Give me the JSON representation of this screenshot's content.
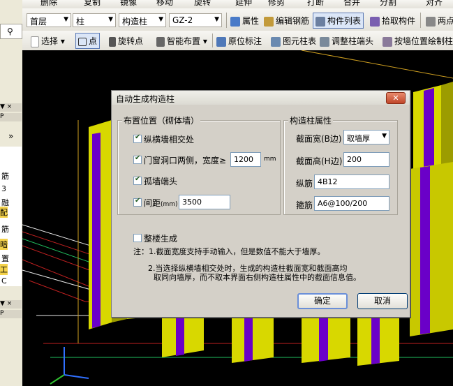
{
  "toolbar_top": {
    "items": [
      "删除",
      "复制",
      "镜像",
      "移动",
      "旋转",
      "延伸",
      "修剪",
      "打断",
      "合并",
      "分割",
      "对齐"
    ]
  },
  "toolbar1": {
    "floor": "首层",
    "category": "柱",
    "type": "构造柱",
    "element": "GZ-2",
    "properties": "属性",
    "edit_rebar": "编辑钢筋",
    "component_list": "构件列表",
    "pick_component": "拾取构件",
    "two_point": "两点"
  },
  "toolbar2": {
    "select": "选择",
    "point": "点",
    "rotate_point": "旋转点",
    "smart_layout": "智能布置",
    "origin_mark": "原位标注",
    "schedule": "图元柱表",
    "adjust_end": "调整柱端头",
    "draw_by_wall": "按墙位置绘制柱"
  },
  "left_panel": {
    "chars": [
      "筋",
      "3",
      "融",
      "配",
      "筋",
      "暗",
      "置",
      "工",
      "C"
    ]
  },
  "dialog": {
    "title": "自动生成构造柱",
    "placement_group": "布置位置（砌体墙）",
    "opt_cross": "纵横墙相交处",
    "opt_opening": "门窗洞口两侧，宽度≥",
    "opening_width": "1200",
    "opening_unit": "mm",
    "opt_isolated": "孤墙端头",
    "opt_spacing": "间距",
    "spacing_unit": "(mm)",
    "spacing_value": "3500",
    "attr_group": "构造柱属性",
    "width_label": "截面宽(B边)",
    "width_value": "取墙厚",
    "height_label": "截面高(H边)",
    "height_value": "200",
    "long_rebar_label": "纵筋",
    "long_rebar_value": "4B12",
    "stirrup_label": "箍筋",
    "stirrup_value": "A6@100/200",
    "whole_building": "整楼生成",
    "note1": "注：1.截面宽度支持手动输入，但是数值不能大于墙厚。",
    "note2a": "2.当选择纵横墙相交处时，生成的构造柱截面宽和截面高均",
    "note2b": "取同向墙厚，而不取本界面右侧构造柱属性中的截面信息值。",
    "ok": "确定",
    "cancel": "取消"
  }
}
